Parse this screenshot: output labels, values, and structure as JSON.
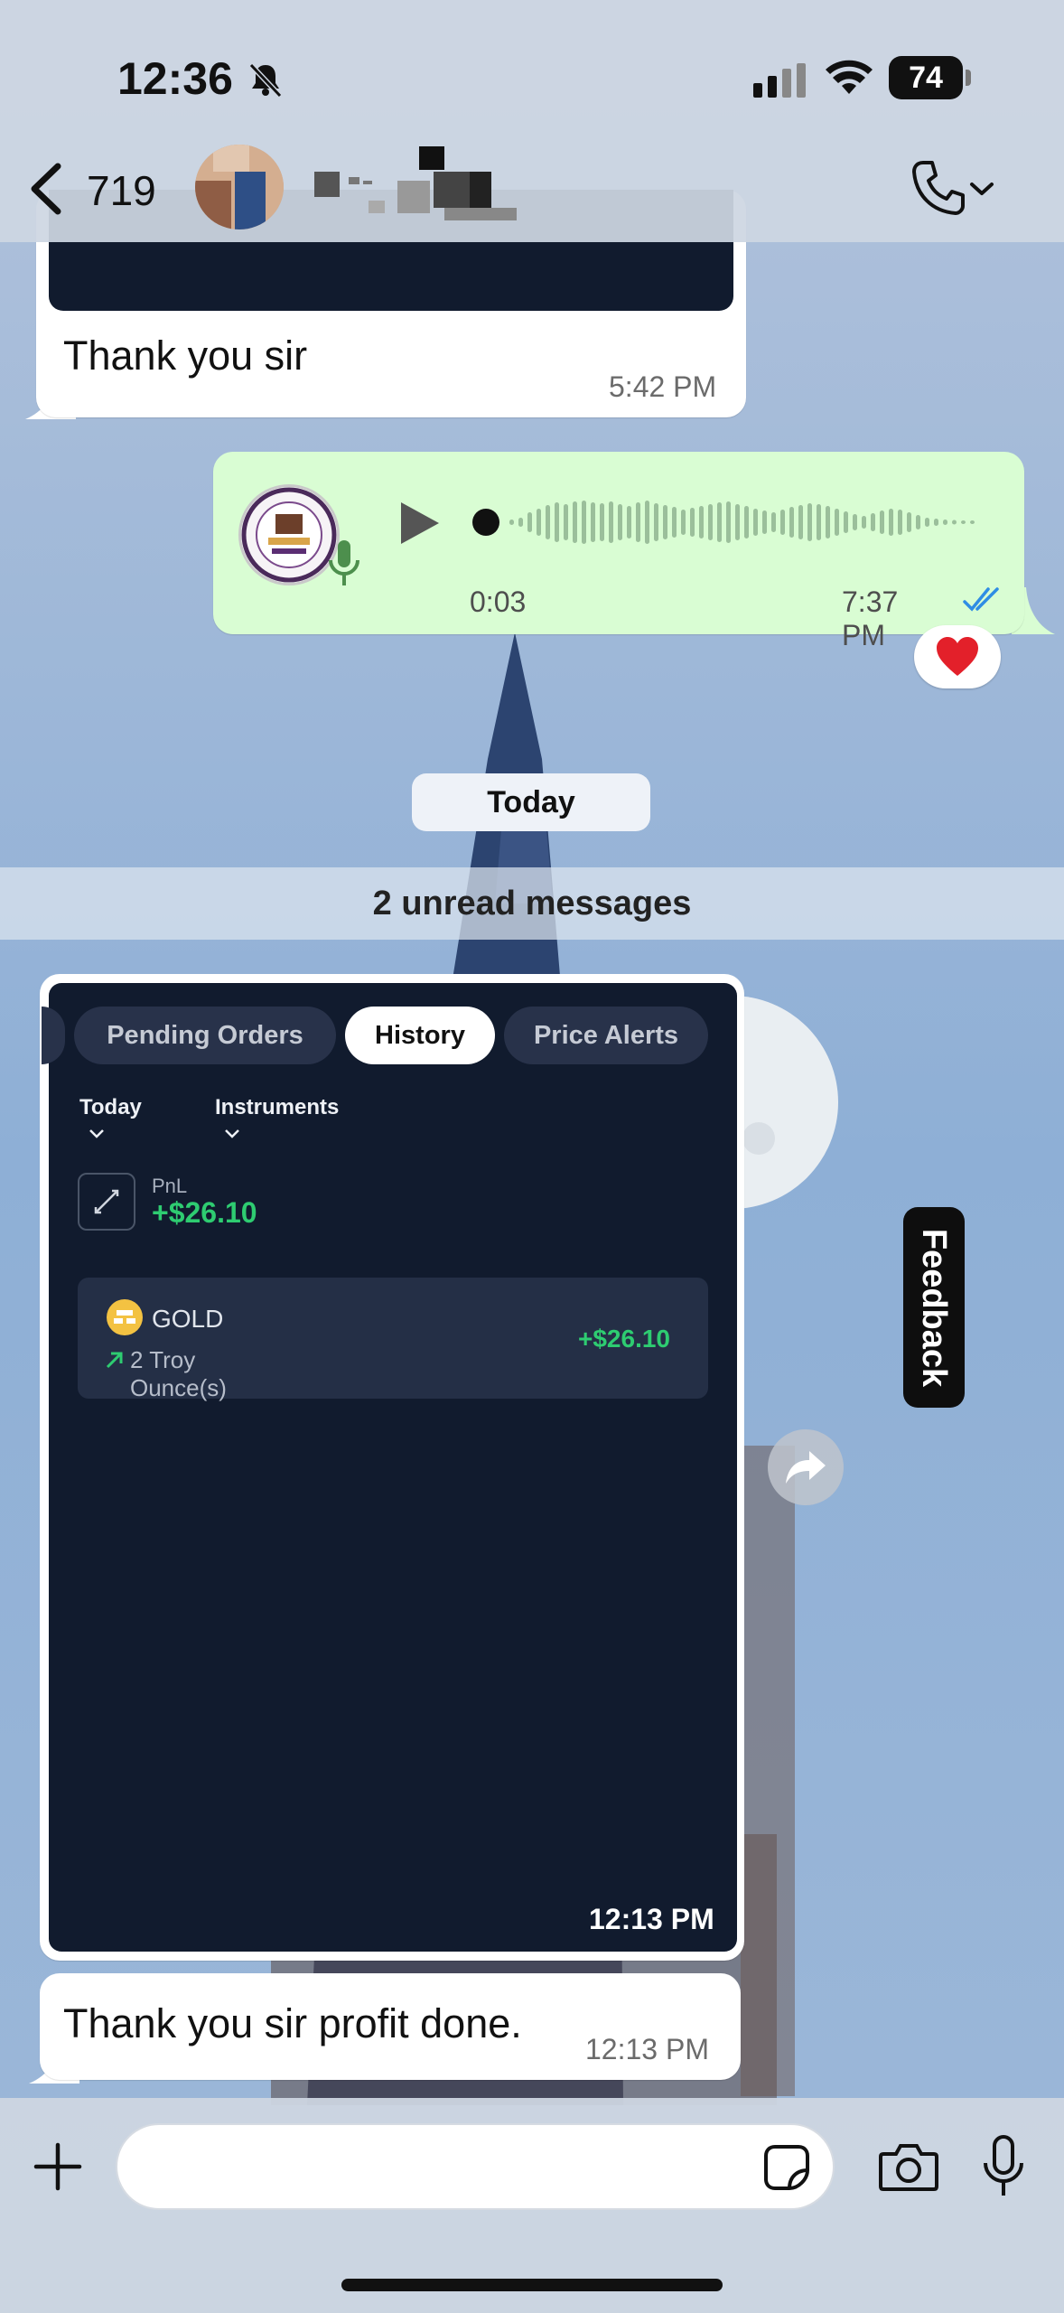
{
  "status_bar": {
    "time": "12:36",
    "battery": "74"
  },
  "header": {
    "back_count": "719"
  },
  "messages": {
    "first_in": {
      "text": "Thank you sir",
      "time": "5:42 PM"
    },
    "voice_note": {
      "duration": "0:03",
      "time": "7:37 PM"
    },
    "reaction": "❤️",
    "day_chip": "Today",
    "unread_banner": "2 unread messages",
    "image_msg": {
      "time": "12:13 PM"
    },
    "last_in": {
      "text": "Thank you sir profit done.",
      "time": "12:13 PM"
    }
  },
  "screenshot": {
    "tabs": [
      "Pending Orders",
      "History",
      "Price Alerts"
    ],
    "active_tab": "History",
    "filters": [
      "Today",
      "Instruments"
    ],
    "pnl_label": "PnL",
    "pnl_value": "+$26.10",
    "instrument": "GOLD",
    "quantity": "2 Troy Ounce(s)",
    "instrument_pnl": "+$26.10"
  },
  "feedback_label": "Feedback",
  "input": {
    "placeholder": ""
  },
  "colors": {
    "outgoing_bubble": "#d9fdd3",
    "incoming_bubble": "#ffffff",
    "profit_green": "#2ecc71",
    "read_ticks": "#2f8de4"
  }
}
